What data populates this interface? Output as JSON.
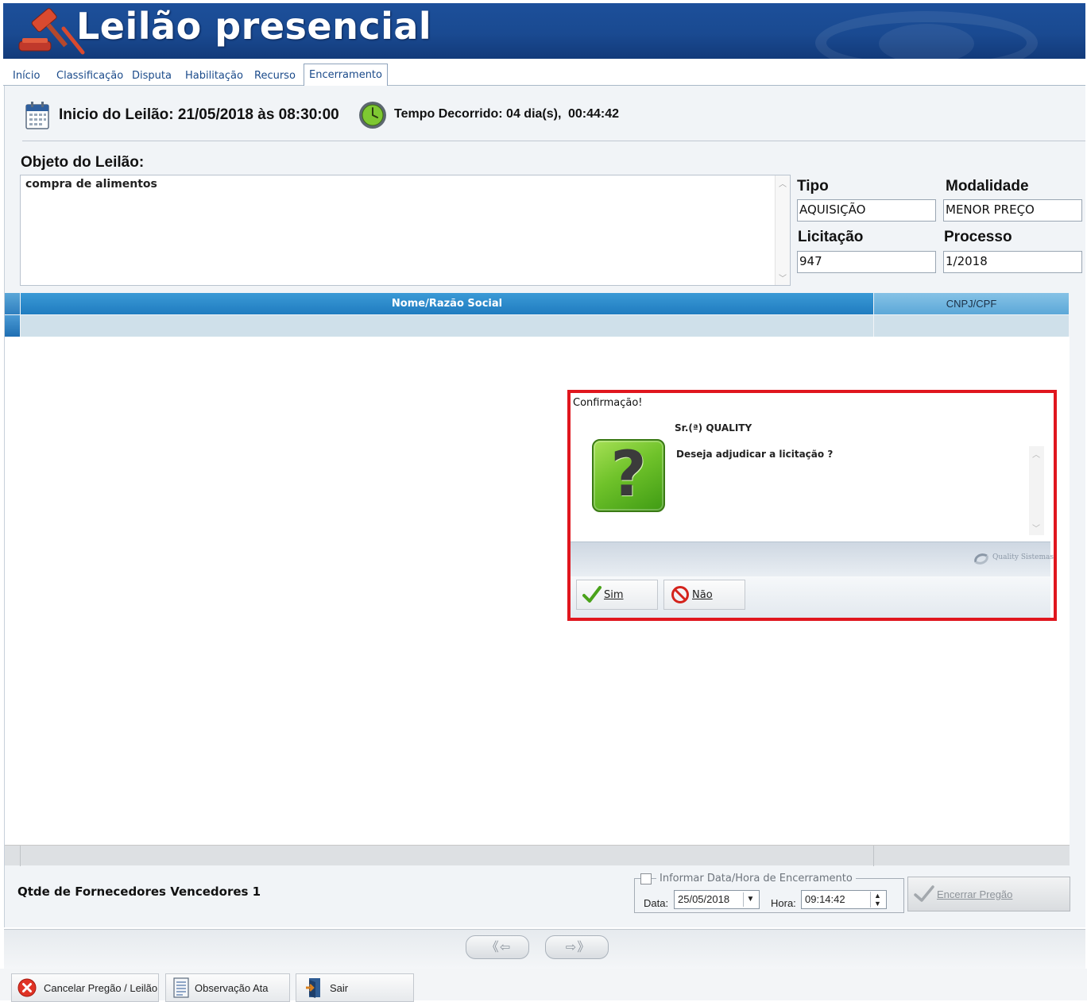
{
  "header": {
    "title": "Leilão presencial"
  },
  "tabs": [
    {
      "label": "Início"
    },
    {
      "label": "Classificação"
    },
    {
      "label": "Disputa"
    },
    {
      "label": "Habilitação"
    },
    {
      "label": "Recurso"
    },
    {
      "label": "Encerramento",
      "active": true
    }
  ],
  "info": {
    "inicio": "Inicio do Leilão: 21/05/2018 às 08:30:00",
    "tempo_label": "Tempo Decorrido: 04 dia(s),",
    "tempo_value": "00:44:42"
  },
  "objeto": {
    "label": "Objeto do Leilão:",
    "value": "compra de alimentos"
  },
  "fields": {
    "tipo_label": "Tipo",
    "tipo_value": "AQUISIÇÃO",
    "modalidade_label": "Modalidade",
    "modalidade_value": "MENOR PREÇO",
    "licitacao_label": "Licitação",
    "licitacao_value": "947",
    "processo_label": "Processo",
    "processo_value": "1/2018"
  },
  "grid": {
    "columns": [
      "Nome/Razão Social",
      "CNPJ/CPF"
    ],
    "rows": [
      [
        "",
        ""
      ]
    ]
  },
  "dialog": {
    "title": "Confirmação!",
    "user": "Sr.(ª) QUALITY",
    "message": "Deseja adjudicar a licitação ?",
    "brand": "Quality Sistemas",
    "yes_label": "Sim",
    "no_label": "Não"
  },
  "footer": {
    "qtde": "Qtde de Fornecedores Vencedores 1",
    "encerramento_label": "Informar Data/Hora de Encerramento",
    "data_label": "Data:",
    "data_value": "25/05/2018",
    "hora_label": "Hora:",
    "hora_value": "09:14:42",
    "encerrar_label": "Encerrar Pregão"
  },
  "bottom_buttons": {
    "cancelar": "Cancelar Pregão / Leilão",
    "observacao": "Observação Ata",
    "sair": "Sair"
  },
  "colors": {
    "header_blue": "#1c4f9a",
    "grid_header_blue": "#2a8acb",
    "dialog_highlight": "#e0161e",
    "question_green": "#6fc22a"
  }
}
